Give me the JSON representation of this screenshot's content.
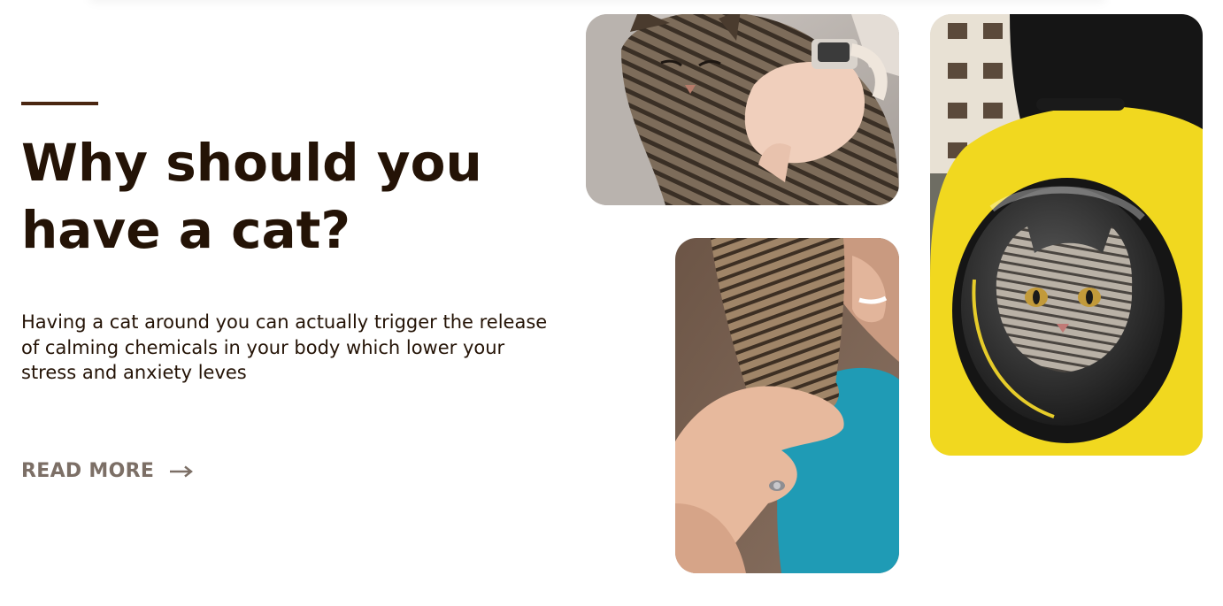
{
  "hero": {
    "title": "Why should you have a cat?",
    "description": "Having a cat around you can actually trigger the release of calming chemicals in your body which lower your stress and anxiety leves",
    "cta_label": "READ MORE",
    "cta_icon": "arrow-right-icon"
  },
  "colors": {
    "heading": "#241306",
    "accent_line": "#4a2611",
    "cta": "#7c6f66",
    "backpack_yellow": "#f1d81f"
  },
  "gallery": {
    "images": [
      {
        "name": "tabby-cat-held-in-arms-photo"
      },
      {
        "name": "person-holding-cat-paw-photo"
      },
      {
        "name": "cat-in-yellow-bubble-backpack-photo"
      }
    ]
  }
}
